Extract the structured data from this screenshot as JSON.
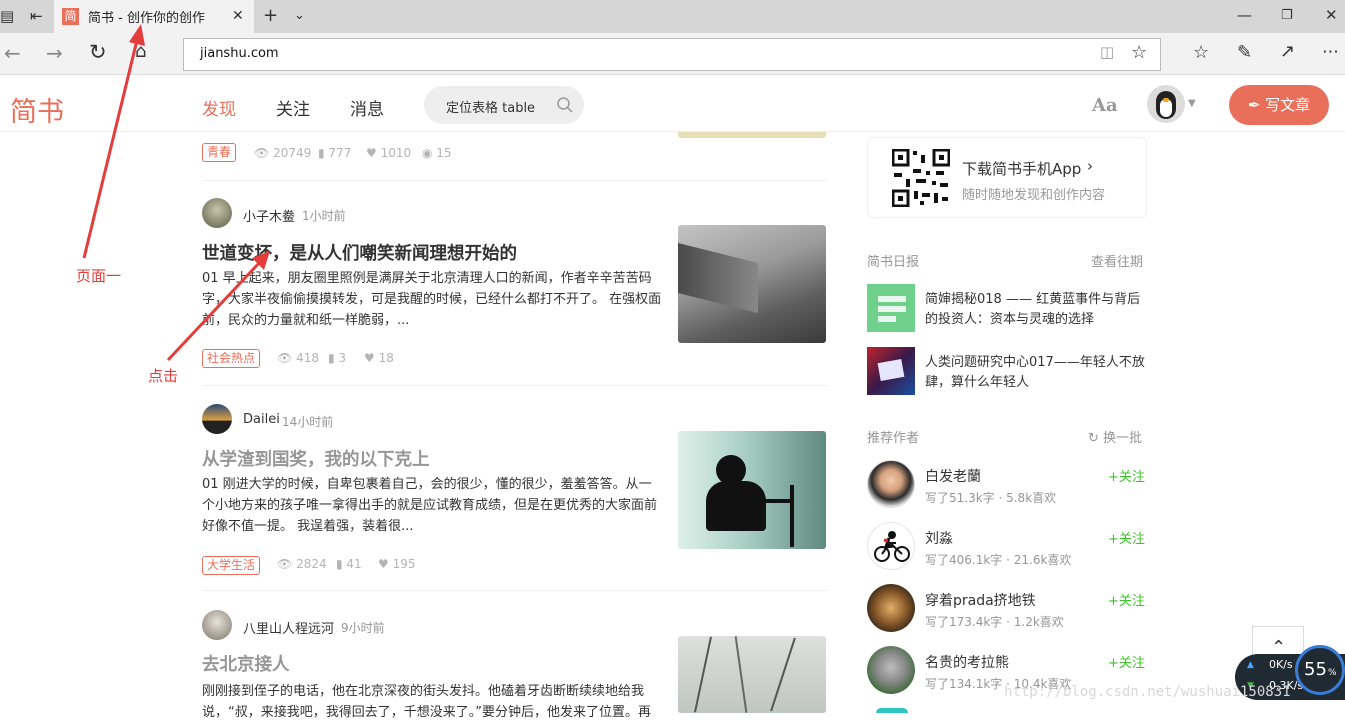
{
  "browser": {
    "tab_icon": "简",
    "tab_title": "简书 - 创作你的创作",
    "url": "jianshu.com",
    "icons": [
      "tab-list-icon",
      "back-tab-icon",
      "close-icon",
      "plus-icon",
      "chevron-down-icon",
      "minimize-icon",
      "restore-icon",
      "window-close-icon",
      "back-arrow-icon",
      "forward-arrow-icon",
      "refresh-icon",
      "home-icon",
      "reading-view-icon",
      "star-icon",
      "favorites-icon",
      "pen-icon",
      "share-icon",
      "more-icon"
    ]
  },
  "site": {
    "logo": "简书",
    "nav": [
      "发现",
      "关注",
      "消息"
    ],
    "search_value": "定位表格 table",
    "aa": "Aa",
    "write_button": "写文章",
    "accent": "#ea6f5a"
  },
  "feed": [
    {
      "partial": true,
      "tag": "青春",
      "views": "20749",
      "comments": "777",
      "likes": "1010",
      "rewards": "15"
    },
    {
      "author": "小子木鲞",
      "time": "1小时前",
      "title": "世道变坏，是从人们嘲笑新闻理想开始的",
      "abstract": "01 早上起来，朋友圈里照例是满屏关于北京清理人口的新闻，作者辛辛苦苦码字，大家半夜偷偷摸摸转发，可是我醒的时候，已经什么都打不开了。 在强权面前，民众的力量就和纸一样脆弱，...",
      "tag": "社会热点",
      "views": "418",
      "comments": "3",
      "likes": "18"
    },
    {
      "author": "Dailei",
      "time": "14小时前",
      "title": "从学渣到国奖，我的以下克上",
      "abstract": "01 刚进大学的时候，自卑包裹着自己，会的很少，懂的很少，羞羞答答。从一个小地方来的孩子唯一拿得出手的就是应试教育成绩，但是在更优秀的大家面前好像不值一提。 我逞着强，装着很...",
      "tag": "大学生活",
      "views": "2824",
      "comments": "41",
      "likes": "195"
    },
    {
      "author": "八里山人程远河",
      "time": "9小时前",
      "title": "去北京接人",
      "abstract": "刚刚接到侄子的电话，他在北京深夜的街头发抖。他磕着牙齿断断续续地给我说，“叔，来接我吧，我得回去了，千想没来了。”要分钟后，他发来了位置。再"
    }
  ],
  "sidebar": {
    "download_title": "下载简书手机App",
    "download_sub": "随时随地发现和创作内容",
    "daily_label": "简书日报",
    "daily_more": "查看往期",
    "daily_items": [
      "简婶揭秘018 —— 红黄蓝事件与背后的投资人：资本与灵魂的选择",
      "人类问题研究中心017——年轻人不放肆，算什么年轻人"
    ],
    "rec_label": "推荐作者",
    "rec_refresh": "换一批",
    "authors": [
      {
        "name": "白发老蘭",
        "info": "写了51.3k字 · 5.8k喜欢",
        "follow": "+关注"
      },
      {
        "name": "刘淼",
        "info": "写了406.1k字 · 21.6k喜欢",
        "follow": "+关注"
      },
      {
        "name": "穿着prada挤地铁",
        "info": "写了173.4k字 · 1.2k喜欢",
        "follow": "+关注"
      },
      {
        "name": "名贵的考拉熊",
        "info": "写了134.1k字 · 10.4k喜欢",
        "follow": "+关注"
      }
    ]
  },
  "annotations": {
    "page_one": "页面一",
    "click": "点击"
  },
  "watermark": "http://blog.csdn.net/wushuai150831",
  "netmon": {
    "up": "0K/s",
    "down": "0.3K/s",
    "percent": "55",
    "percent_unit": "%"
  }
}
